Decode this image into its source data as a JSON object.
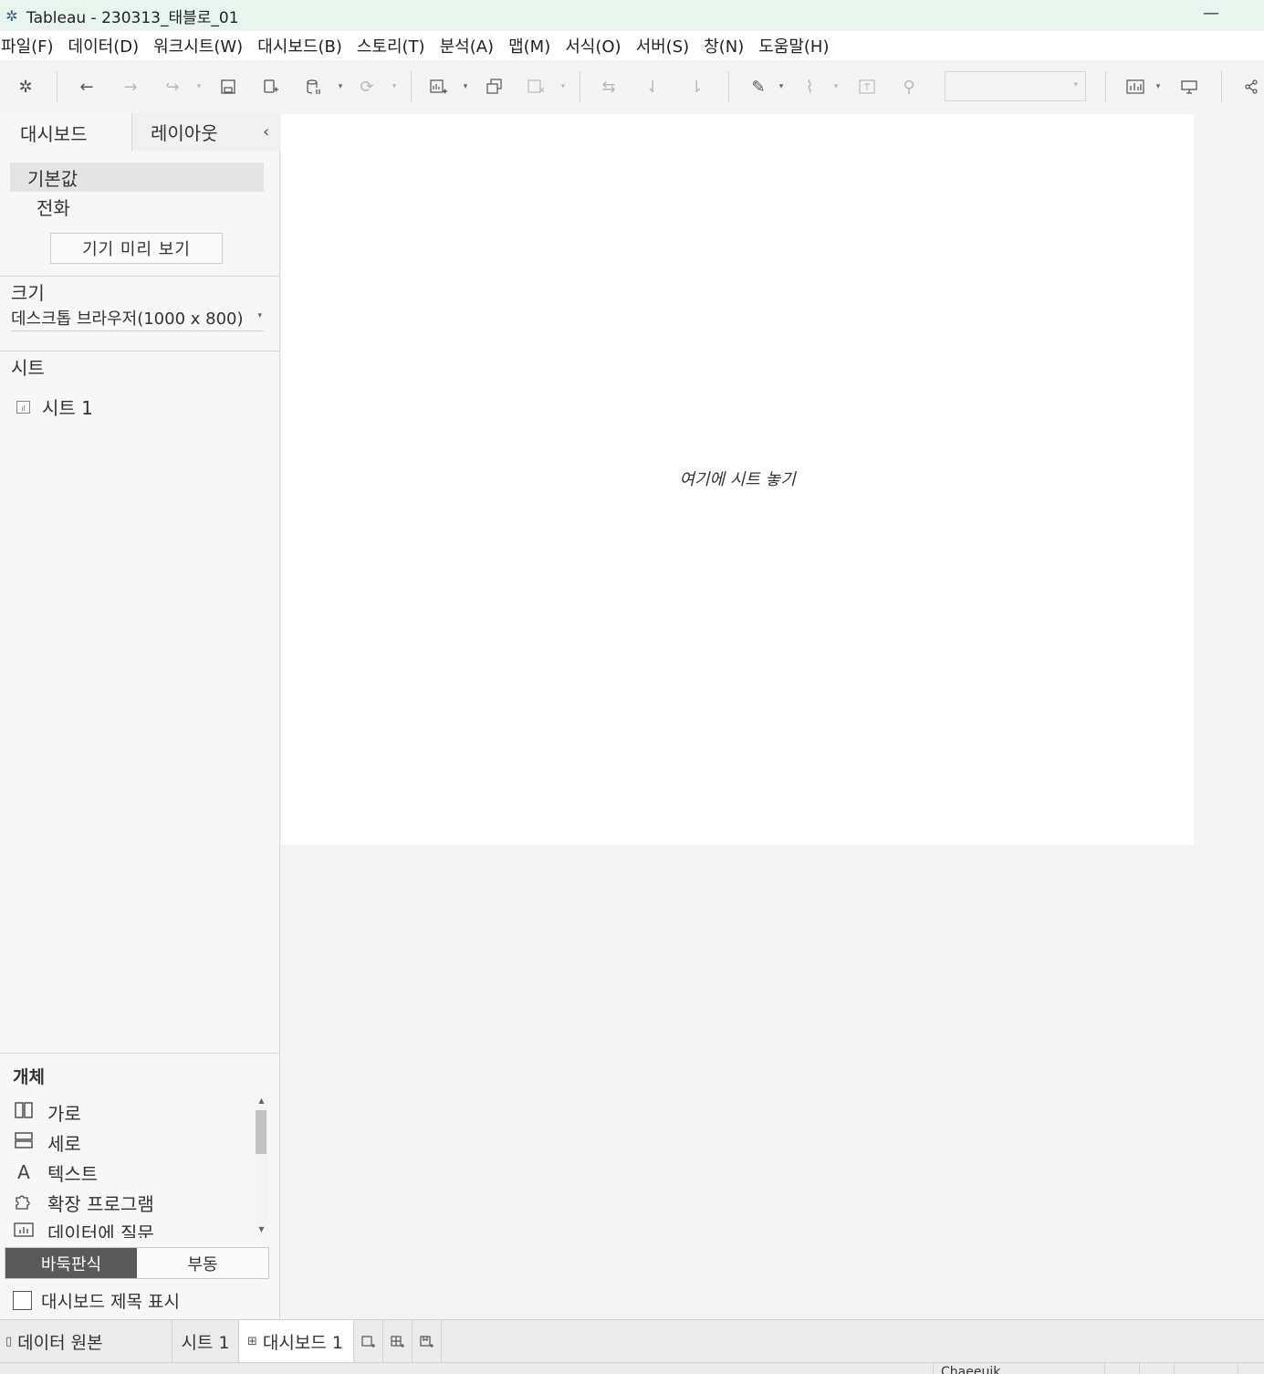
{
  "window": {
    "title": "Tableau - 230313_태블로_01",
    "app_icon": "tableau-logo-icon",
    "minimize_glyph": "—"
  },
  "menu": [
    "파일(F)",
    "데이터(D)",
    "워크시트(W)",
    "대시보드(B)",
    "스토리(T)",
    "분석(A)",
    "맵(M)",
    "서식(O)",
    "서버(S)",
    "창(N)",
    "도움말(H)"
  ],
  "left_panel": {
    "tabs": {
      "dashboard": "대시보드",
      "layout": "레이아웃",
      "collapse": "‹"
    },
    "device": {
      "default": "기본값",
      "phone": "전화",
      "preview_button": "기기 미리 보기"
    },
    "size": {
      "label": "크기",
      "value": "데스크톱 브라우저(1000 x 800)"
    },
    "sheets": {
      "label": "시트",
      "items": [
        "시트 1"
      ]
    },
    "objects": {
      "label": "개체",
      "items": [
        {
          "label": "가로",
          "icon": "horizontal-container-icon"
        },
        {
          "label": "세로",
          "icon": "vertical-container-icon"
        },
        {
          "label": "텍스트",
          "icon": "text-icon"
        },
        {
          "label": "확장 프로그램",
          "icon": "extension-icon"
        },
        {
          "label": "데이터에 질문",
          "icon": "ask-data-icon"
        }
      ],
      "tiled": "바둑판식",
      "floating": "부동"
    },
    "show_title": "대시보드 제목 표시"
  },
  "canvas": {
    "drop_hint": "여기에 시트 놓기"
  },
  "bottom_tabs": {
    "data_source": "데이터 원본",
    "sheet": "시트 1",
    "dashboard": "대시보드 1"
  },
  "status": {
    "user": "Chaeeuik"
  }
}
